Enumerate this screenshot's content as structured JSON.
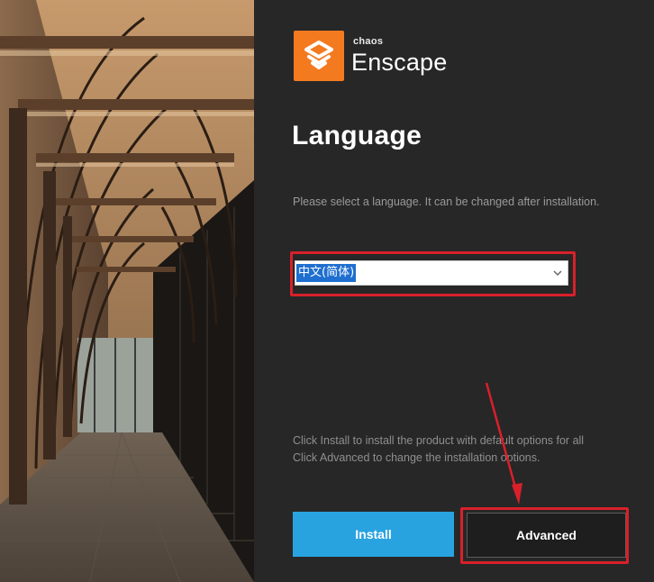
{
  "brand": {
    "company": "chaos",
    "product": "Enscape",
    "logo_icon": "enscape-logo-icon",
    "accent_color": "#f47a20"
  },
  "page": {
    "title": "Language",
    "subtitle": "Please select a language. It can be changed after installation."
  },
  "language_select": {
    "value": "中文(简体)",
    "highlight_color": "#d8202a"
  },
  "info": {
    "line1": "Click Install to install the product with default options for all",
    "line2": "Click Advanced to change the installation options."
  },
  "buttons": {
    "install_label": "Install",
    "advanced_label": "Advanced",
    "install_color": "#29a3e0"
  }
}
